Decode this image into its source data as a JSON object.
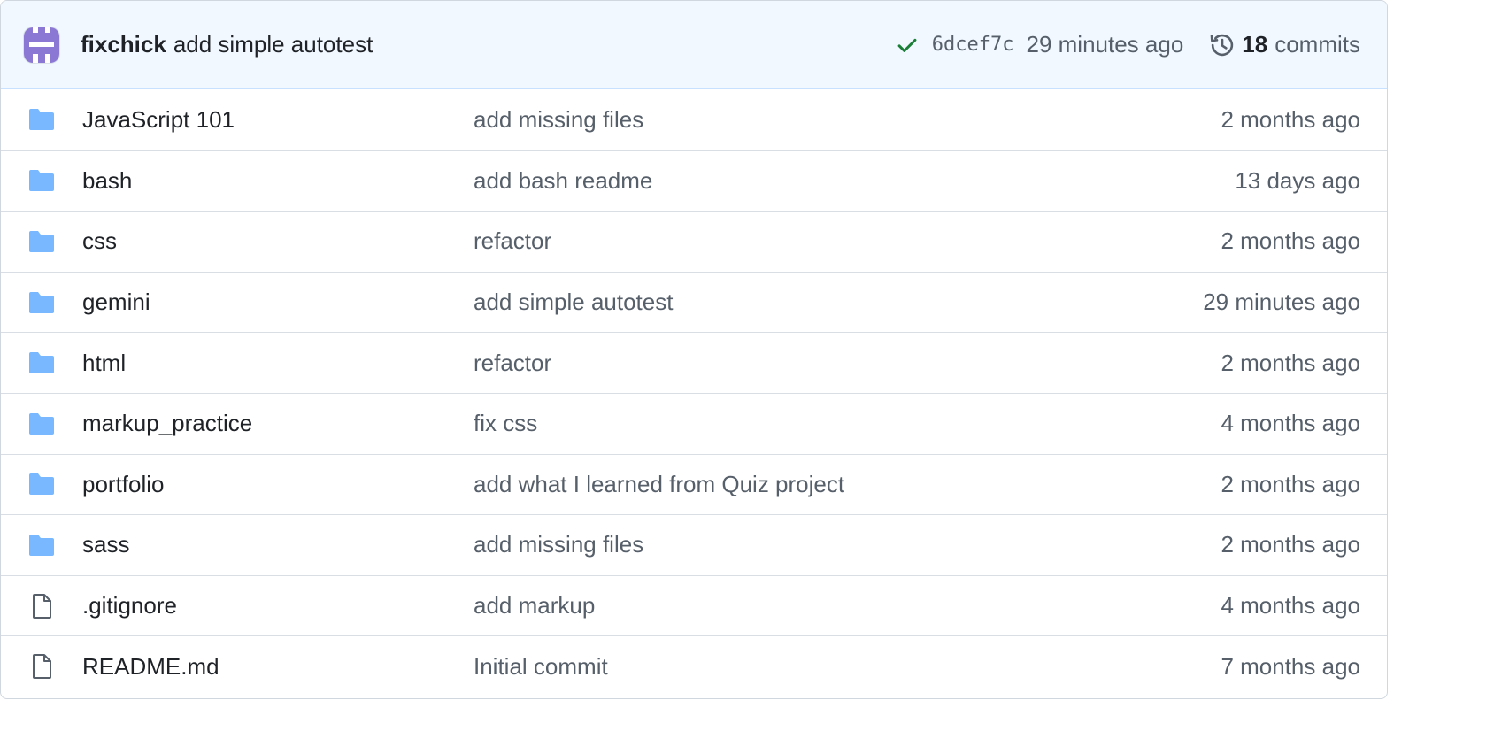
{
  "latest_commit": {
    "author": "fixchick",
    "message": "add simple autotest",
    "status": "success",
    "sha": "6dcef7c",
    "time": "29 minutes ago",
    "commits_count": "18",
    "commits_label": "commits",
    "avatar_color": "#8b78d4",
    "check_color": "#1a7f37"
  },
  "folder_color": "#79b8ff",
  "files": [
    {
      "name": "JavaScript 101",
      "type": "folder",
      "message": "add missing files",
      "time": "2 months ago"
    },
    {
      "name": "bash",
      "type": "folder",
      "message": "add bash readme",
      "time": "13 days ago"
    },
    {
      "name": "css",
      "type": "folder",
      "message": "refactor",
      "time": "2 months ago"
    },
    {
      "name": "gemini",
      "type": "folder",
      "message": "add simple autotest",
      "time": "29 minutes ago"
    },
    {
      "name": "html",
      "type": "folder",
      "message": "refactor",
      "time": "2 months ago"
    },
    {
      "name": "markup_practice",
      "type": "folder",
      "message": "fix css",
      "time": "4 months ago"
    },
    {
      "name": "portfolio",
      "type": "folder",
      "message": "add what I learned from Quiz project",
      "time": "2 months ago"
    },
    {
      "name": "sass",
      "type": "folder",
      "message": "add missing files",
      "time": "2 months ago"
    },
    {
      "name": ".gitignore",
      "type": "file",
      "message": "add markup",
      "time": "4 months ago"
    },
    {
      "name": "README.md",
      "type": "file",
      "message": "Initial commit",
      "time": "7 months ago"
    }
  ]
}
